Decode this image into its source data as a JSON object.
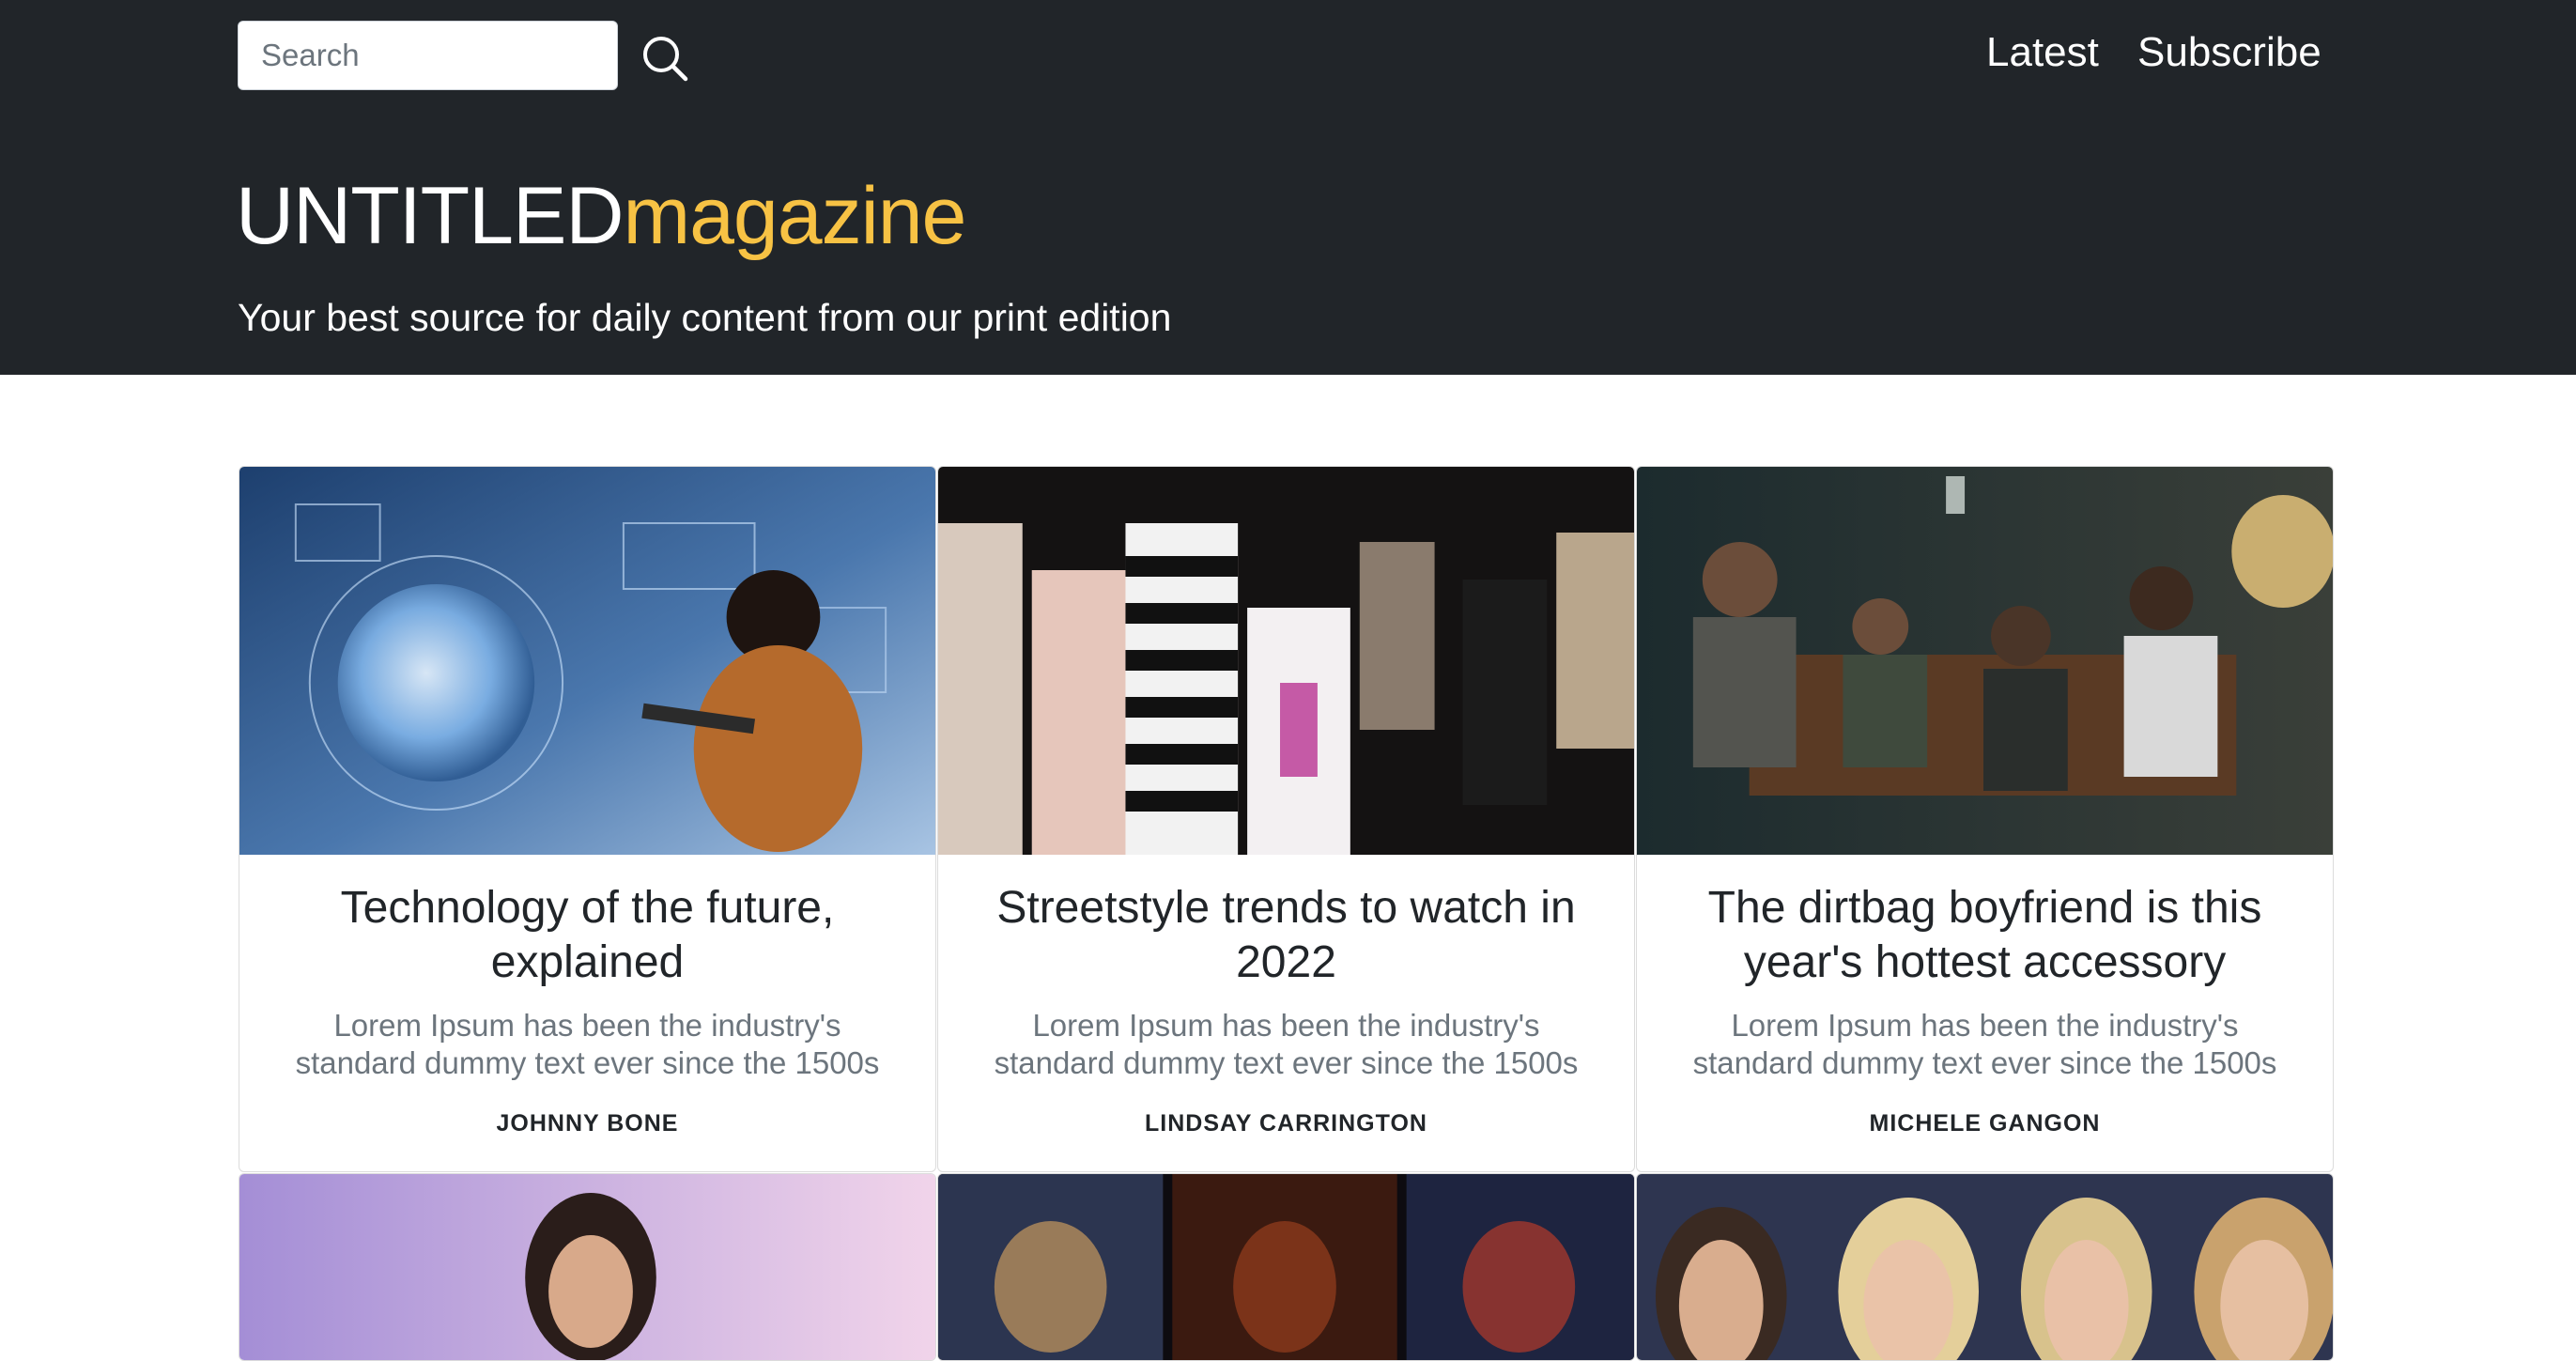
{
  "header": {
    "search_placeholder": "Search",
    "nav": {
      "latest": "Latest",
      "subscribe": "Subscribe"
    },
    "brand_white": "UNTITLED",
    "brand_yellow": "magazine",
    "tagline": "Your best source for daily content from our print edition",
    "colors": {
      "background": "#212529",
      "accent": "#f7c244"
    }
  },
  "articles": [
    {
      "title": "Technology of the future, explained",
      "excerpt": "Lorem Ipsum has been the industry's standard dummy text ever since the 1500s",
      "author": "JOHNNY BONE"
    },
    {
      "title": "Streetstyle trends to watch in 2022",
      "excerpt": "Lorem Ipsum has been the industry's standard dummy text ever since the 1500s",
      "author": "LINDSAY CARRINGTON"
    },
    {
      "title": "The dirtbag boyfriend is this year's hottest accessory",
      "excerpt": "Lorem Ipsum has been the industry's standard dummy text ever since the 1500s",
      "author": "MICHELE GANGON"
    }
  ],
  "icons": {
    "search": "search-icon"
  }
}
